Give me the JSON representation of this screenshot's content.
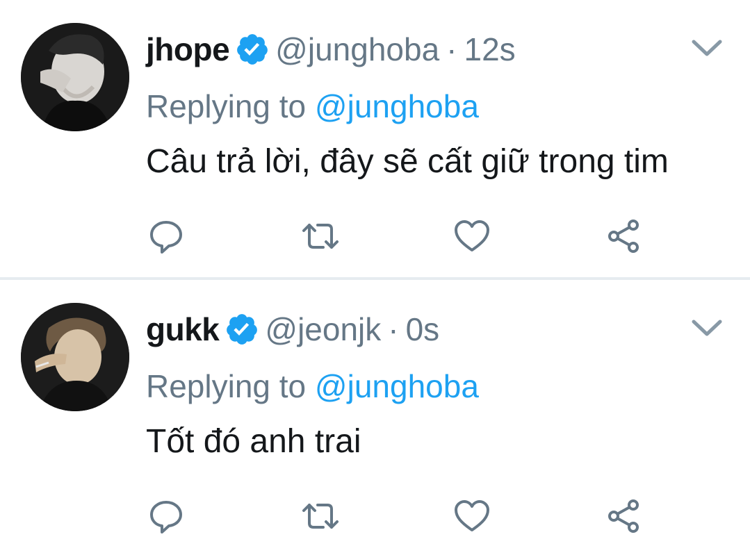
{
  "tweets": [
    {
      "display_name": "jhope",
      "handle": "@junghoba",
      "separator": "·",
      "time": "12s",
      "replying_prefix": "Replying to",
      "replying_to": "@junghoba",
      "text": "Câu trả lời, đây sẽ cất giữ trong tim"
    },
    {
      "display_name": "gukk",
      "handle": "@jeonjk",
      "separator": "·",
      "time": "0s",
      "replying_prefix": "Replying to",
      "replying_to": "@junghoba",
      "text": "Tốt đó anh trai"
    }
  ],
  "icons": {
    "verified": "verified-badge-icon",
    "menu": "chevron-down-icon",
    "reply": "reply-icon",
    "retweet": "retweet-icon",
    "like": "heart-icon",
    "share": "share-icon"
  },
  "colors": {
    "text": "#14171a",
    "secondary": "#657786",
    "accent": "#1da1f2",
    "divider": "#e6ecf0"
  }
}
